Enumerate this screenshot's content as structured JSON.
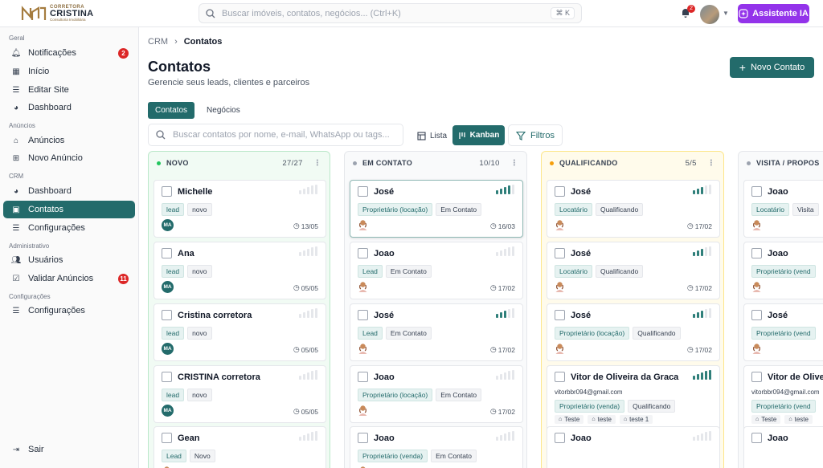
{
  "brand": {
    "top": "CORRETORA",
    "main": "CRISTINA",
    "sub": "Consultoria Imobiliária"
  },
  "search": {
    "placeholder": "Buscar imóveis, contatos, negócios... (Ctrl+K)",
    "shortcut": "⌘ K"
  },
  "header": {
    "notif_count": "2",
    "ai_label": "Assistente IA"
  },
  "sidebar": {
    "sections": [
      "Geral",
      "Anúncios",
      "CRM",
      "Administrativo",
      "Configurações"
    ],
    "items": [
      {
        "label": "Notificações",
        "icon": "bell-icon",
        "badge": "2"
      },
      {
        "label": "Início",
        "icon": "grid-icon"
      },
      {
        "label": "Editar Site",
        "icon": "list-icon"
      },
      {
        "label": "Dashboard",
        "icon": "pie-chart-icon"
      },
      {
        "label": "Anúncios",
        "icon": "home-icon"
      },
      {
        "label": "Novo Anúncio",
        "icon": "plus-square-icon"
      },
      {
        "label": "Dashboard",
        "icon": "pie-chart-icon"
      },
      {
        "label": "Contatos",
        "icon": "contact-book-icon",
        "active": true
      },
      {
        "label": "Configurações",
        "icon": "sliders-icon"
      },
      {
        "label": "Usuários",
        "icon": "users-icon"
      },
      {
        "label": "Validar Anúncios",
        "icon": "clipboard-check-icon",
        "badge": "11"
      },
      {
        "label": "Configurações",
        "icon": "sliders-icon"
      }
    ],
    "logout": "Sair"
  },
  "breadcrumb": {
    "root": "CRM",
    "current": "Contatos"
  },
  "page": {
    "title": "Contatos",
    "subtitle": "Gerencie seus leads, clientes e parceiros",
    "new_button": "Novo Contato"
  },
  "tabs": [
    "Contatos",
    "Negócios"
  ],
  "toolbar": {
    "search_placeholder": "Buscar contatos por nome, e-mail, WhatsApp ou tags...",
    "list_label": "Lista",
    "kanban_label": "Kanban",
    "filters_label": "Filtros"
  },
  "colors": {
    "primary": "#236b6b",
    "ai": "#9333ea",
    "badge": "#dc2626",
    "novo": "#22c55e",
    "em_contato": "#9ca3af",
    "qualificando": "#f59e0b"
  },
  "columns": [
    {
      "title": "NOVO",
      "count": "27/27",
      "cards": [
        {
          "name": "Michelle",
          "tags": [
            "lead",
            "novo"
          ],
          "avatar": "MA",
          "date": "13/05",
          "score": 0
        },
        {
          "name": "Ana",
          "tags": [
            "lead",
            "novo"
          ],
          "avatar": "MA",
          "date": "05/05",
          "score": 0
        },
        {
          "name": "Cristina corretora",
          "tags": [
            "lead",
            "novo"
          ],
          "avatar": "MA",
          "date": "05/05",
          "score": 0
        },
        {
          "name": "CRISTINA corretora",
          "tags": [
            "lead",
            "novo"
          ],
          "avatar": "MA",
          "date": "05/05",
          "score": 0
        },
        {
          "name": "Gean",
          "tags": [
            "Lead",
            "Novo"
          ],
          "score": 0
        }
      ]
    },
    {
      "title": "EM CONTATO",
      "count": "10/10",
      "cards": [
        {
          "name": "José",
          "tags": [
            "Proprietário (locação)",
            "Em Contato"
          ],
          "date": "16/03",
          "score": 4
        },
        {
          "name": "Joao",
          "tags": [
            "Lead",
            "Em Contato"
          ],
          "date": "17/02",
          "score": 0
        },
        {
          "name": "José",
          "tags": [
            "Lead",
            "Em Contato"
          ],
          "date": "17/02",
          "score": 3
        },
        {
          "name": "Joao",
          "tags": [
            "Proprietário (locação)",
            "Em Contato"
          ],
          "date": "17/02",
          "score": 0
        },
        {
          "name": "Joao",
          "tags": [
            "Proprietário (venda)",
            "Em Contato"
          ],
          "score": 0
        }
      ]
    },
    {
      "title": "QUALIFICANDO",
      "count": "5/5",
      "cards": [
        {
          "name": "José",
          "tags": [
            "Locatário",
            "Qualificando"
          ],
          "date": "17/02",
          "score": 3
        },
        {
          "name": "José",
          "tags": [
            "Locatário",
            "Qualificando"
          ],
          "date": "17/02",
          "score": 3
        },
        {
          "name": "José",
          "tags": [
            "Proprietário (locação)",
            "Qualificando"
          ],
          "date": "17/02",
          "score": 3
        },
        {
          "name": "Vitor de Oliveira da Graca",
          "email": "vitorbbr094@gmail.com",
          "tags": [
            "Proprietário (venda)",
            "Qualificando"
          ],
          "mini_tags": [
            "Teste",
            "teste",
            "teste 1"
          ],
          "date": "17/02",
          "score": 5
        },
        {
          "name": "Joao",
          "tags": [],
          "score": 0
        }
      ]
    },
    {
      "title": "VISITA / PROPOS",
      "cards": [
        {
          "name": "Joao",
          "tags": [
            "Locatário",
            "Visita"
          ]
        },
        {
          "name": "Joao",
          "tags": [
            "Proprietário (vend"
          ]
        },
        {
          "name": "José",
          "tags": [
            "Proprietário (vend"
          ]
        },
        {
          "name": "Vitor de Olive",
          "email": "vitorbbr094@gmail.com",
          "tags": [
            "Proprietário (vend"
          ],
          "mini_tags": [
            "Teste",
            "teste"
          ]
        },
        {
          "name": "Joao",
          "tags": []
        }
      ]
    }
  ]
}
